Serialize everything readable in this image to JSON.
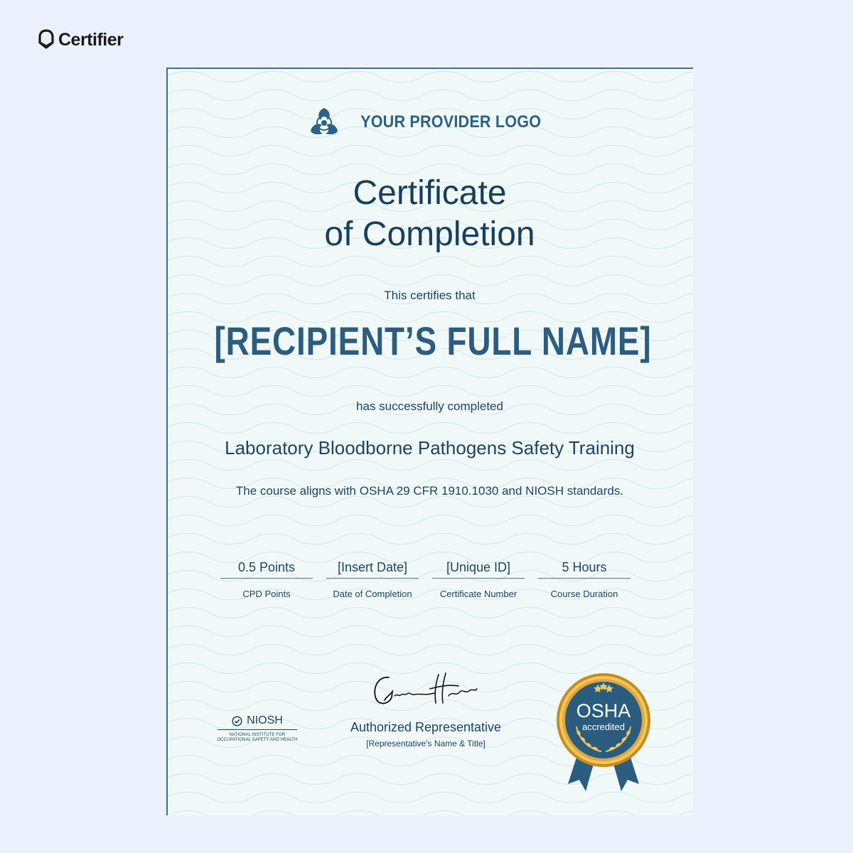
{
  "brand": {
    "name": "Certifier",
    "icon": "certifier-shield-icon"
  },
  "certificate": {
    "provider_logo_text": "YOUR PROVIDER LOGO",
    "provider_logo_icon": "biohazard-icon",
    "title_line1": "Certificate",
    "title_line2": "of Completion",
    "certifies_text": "This certifies that",
    "recipient_name": "[RECIPIENT’S FULL NAME]",
    "completed_text": "has successfully completed",
    "course_name": "Laboratory Bloodborne Pathogens Safety Training",
    "alignment_text": "The course aligns with OSHA 29 CFR 1910.1030 and NIOSH standards.",
    "fields": [
      {
        "value": "0.5 Points",
        "label": "CPD Points"
      },
      {
        "value": "[Insert Date]",
        "label": "Date of Completion"
      },
      {
        "value": "[Unique ID]",
        "label": "Certificate Number"
      },
      {
        "value": "5 Hours",
        "label": "Course Duration"
      }
    ],
    "niosh": {
      "name": "NIOSH",
      "subtitle_line1": "NATIONAL INSTITUTE FOR",
      "subtitle_line2": "OCCUPATIONAL SAFETY AND HEALTH"
    },
    "signature": {
      "title": "Authorized Representative",
      "subtitle": "[Representative's Name & Title]"
    },
    "seal": {
      "title": "OSHA",
      "subtitle": "accredited"
    }
  },
  "colors": {
    "page_background": "#eaf1fd",
    "paper_background": "#f1f9f8",
    "primary_text": "#1d4461",
    "accent_blue": "#2c5c80",
    "seal_gold": "#e0a93a",
    "seal_blue": "#2a5c80"
  }
}
